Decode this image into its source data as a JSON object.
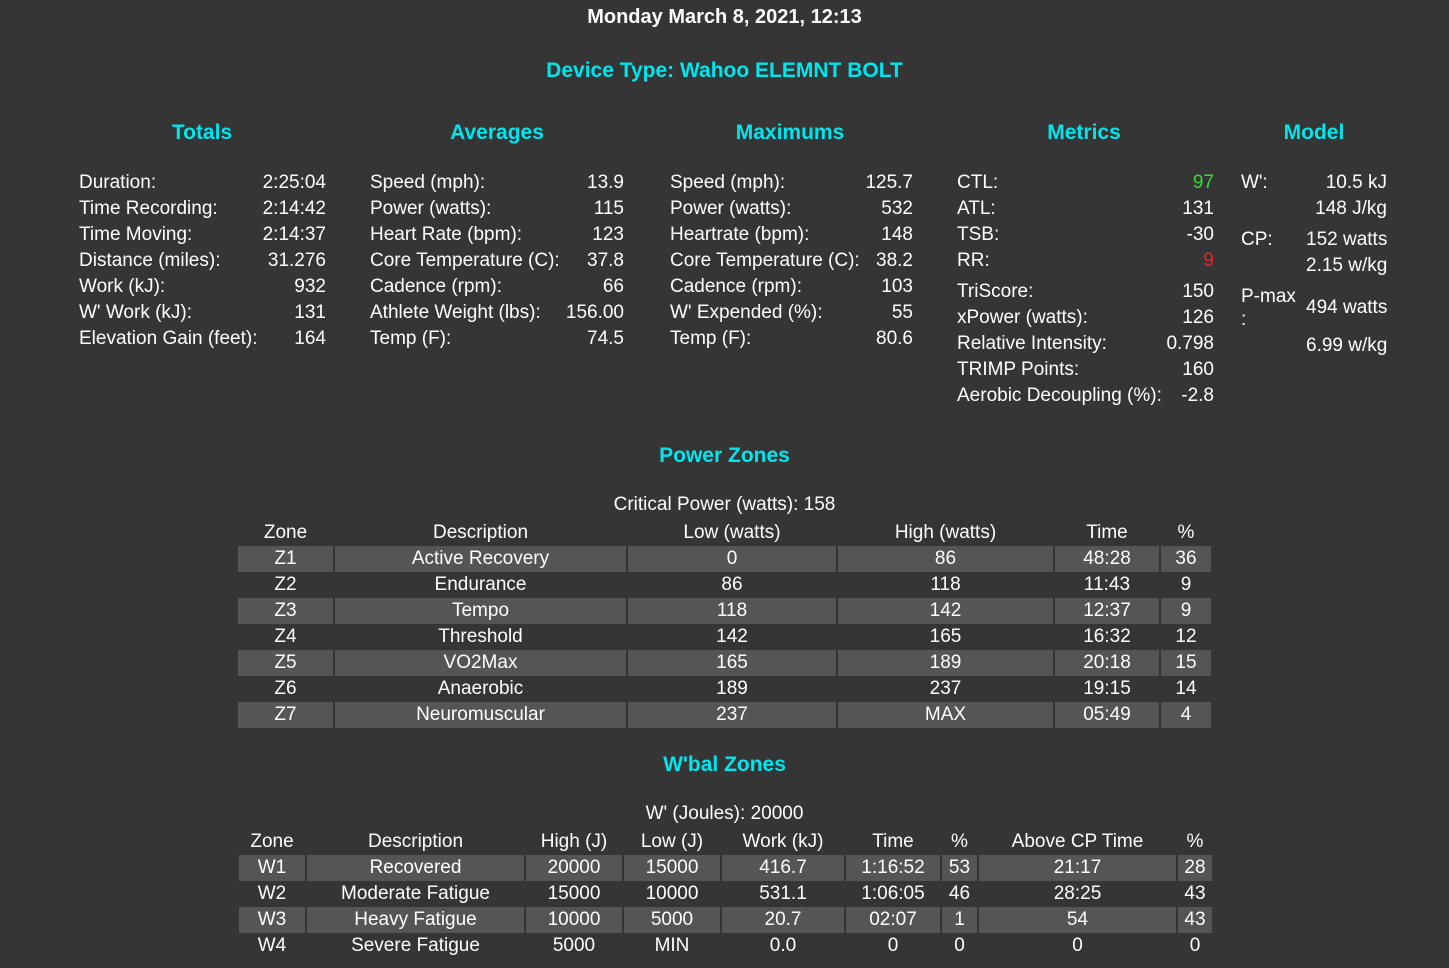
{
  "header": {
    "date": "Monday March 8, 2021, 12:13",
    "device": "Device Type: Wahoo ELEMNT BOLT"
  },
  "columns": {
    "totals": {
      "title": "Totals",
      "items": [
        {
          "label": "Duration:",
          "value": "2:25:04"
        },
        {
          "label": "Time Recording:",
          "value": "2:14:42"
        },
        {
          "label": "Time Moving:",
          "value": "2:14:37"
        },
        {
          "label": "Distance (miles):",
          "value": "31.276"
        },
        {
          "label": "Work (kJ):",
          "value": "932"
        },
        {
          "label": "W' Work (kJ):",
          "value": "131"
        },
        {
          "label": "Elevation Gain (feet):",
          "value": "164"
        }
      ]
    },
    "averages": {
      "title": "Averages",
      "items": [
        {
          "label": "Speed (mph):",
          "value": "13.9"
        },
        {
          "label": "Power (watts):",
          "value": "115"
        },
        {
          "label": "Heart Rate (bpm):",
          "value": "123"
        },
        {
          "label": "Core Temperature (C):",
          "value": "37.8"
        },
        {
          "label": "Cadence (rpm):",
          "value": "66"
        },
        {
          "label": "Athlete Weight (lbs):",
          "value": "156.00"
        },
        {
          "label": "Temp (F):",
          "value": "74.5"
        }
      ]
    },
    "maximums": {
      "title": "Maximums",
      "items": [
        {
          "label": "Speed (mph):",
          "value": "125.7"
        },
        {
          "label": "Power (watts):",
          "value": "532"
        },
        {
          "label": "Heartrate (bpm):",
          "value": "148"
        },
        {
          "label": "Core Temperature (C):",
          "value": "38.2"
        },
        {
          "label": "Cadence (rpm):",
          "value": "103"
        },
        {
          "label": "W' Expended (%):",
          "value": "55"
        },
        {
          "label": "Temp (F):",
          "value": "80.6"
        }
      ]
    },
    "metrics": {
      "title": "Metrics",
      "items": [
        {
          "label": "CTL:",
          "value": "97"
        },
        {
          "label": "ATL:",
          "value": "131"
        },
        {
          "label": "TSB:",
          "value": "-30"
        },
        {
          "label": "RR:",
          "value": "9"
        },
        {
          "label": "TriScore:",
          "value": "150"
        },
        {
          "label": "xPower (watts):",
          "value": "126"
        },
        {
          "label": "Relative Intensity:",
          "value": "0.798"
        },
        {
          "label": "TRIMP Points:",
          "value": "160"
        },
        {
          "label": "Aerobic Decoupling (%):",
          "value": "-2.8"
        }
      ],
      "colors": {
        "ctl": "#33dd33",
        "rr": "#ee2222"
      }
    },
    "model": {
      "title": "Model",
      "w_label": "W':",
      "w_value1": "10.5 kJ",
      "w_value2": "148 J/kg",
      "cp_label": "CP:",
      "cp_value1": "152 watts",
      "cp_value2": "2.15 w/kg",
      "pmax_label": "P-max",
      "pmax_colon": ":",
      "pmax_value1": "494 watts",
      "pmax_value2": "6.99 w/kg"
    }
  },
  "power_zones": {
    "title": "Power Zones",
    "subtitle": "Critical Power (watts): 158",
    "headers": [
      "Zone",
      "Description",
      "Low (watts)",
      "High (watts)",
      "Time",
      "%"
    ],
    "rows": [
      [
        "Z1",
        "Active Recovery",
        "0",
        "86",
        "48:28",
        "36"
      ],
      [
        "Z2",
        "Endurance",
        "86",
        "118",
        "11:43",
        "9"
      ],
      [
        "Z3",
        "Tempo",
        "118",
        "142",
        "12:37",
        "9"
      ],
      [
        "Z4",
        "Threshold",
        "142",
        "165",
        "16:32",
        "12"
      ],
      [
        "Z5",
        "VO2Max",
        "165",
        "189",
        "20:18",
        "15"
      ],
      [
        "Z6",
        "Anaerobic",
        "189",
        "237",
        "19:15",
        "14"
      ],
      [
        "Z7",
        "Neuromuscular",
        "237",
        "MAX",
        "05:49",
        "4"
      ]
    ]
  },
  "wbal_zones": {
    "title": "W'bal Zones",
    "subtitle": "W' (Joules): 20000",
    "headers": [
      "Zone",
      "Description",
      "High (J)",
      "Low (J)",
      "Work (kJ)",
      "Time",
      "%",
      "Above CP Time",
      "%"
    ],
    "rows": [
      [
        "W1",
        "Recovered",
        "20000",
        "15000",
        "416.7",
        "1:16:52",
        "53",
        "21:17",
        "28"
      ],
      [
        "W2",
        "Moderate Fatigue",
        "15000",
        "10000",
        "531.1",
        "1:06:05",
        "46",
        "28:25",
        "43"
      ],
      [
        "W3",
        "Heavy Fatigue",
        "10000",
        "5000",
        "20.7",
        "02:07",
        "1",
        "54",
        "43"
      ],
      [
        "W4",
        "Severe Fatigue",
        "5000",
        "MIN",
        "0.0",
        "0",
        "0",
        "0",
        "0"
      ]
    ]
  },
  "theme": {
    "background": "#353535",
    "accent": "#00e5ee",
    "row_shade": "#555555"
  }
}
